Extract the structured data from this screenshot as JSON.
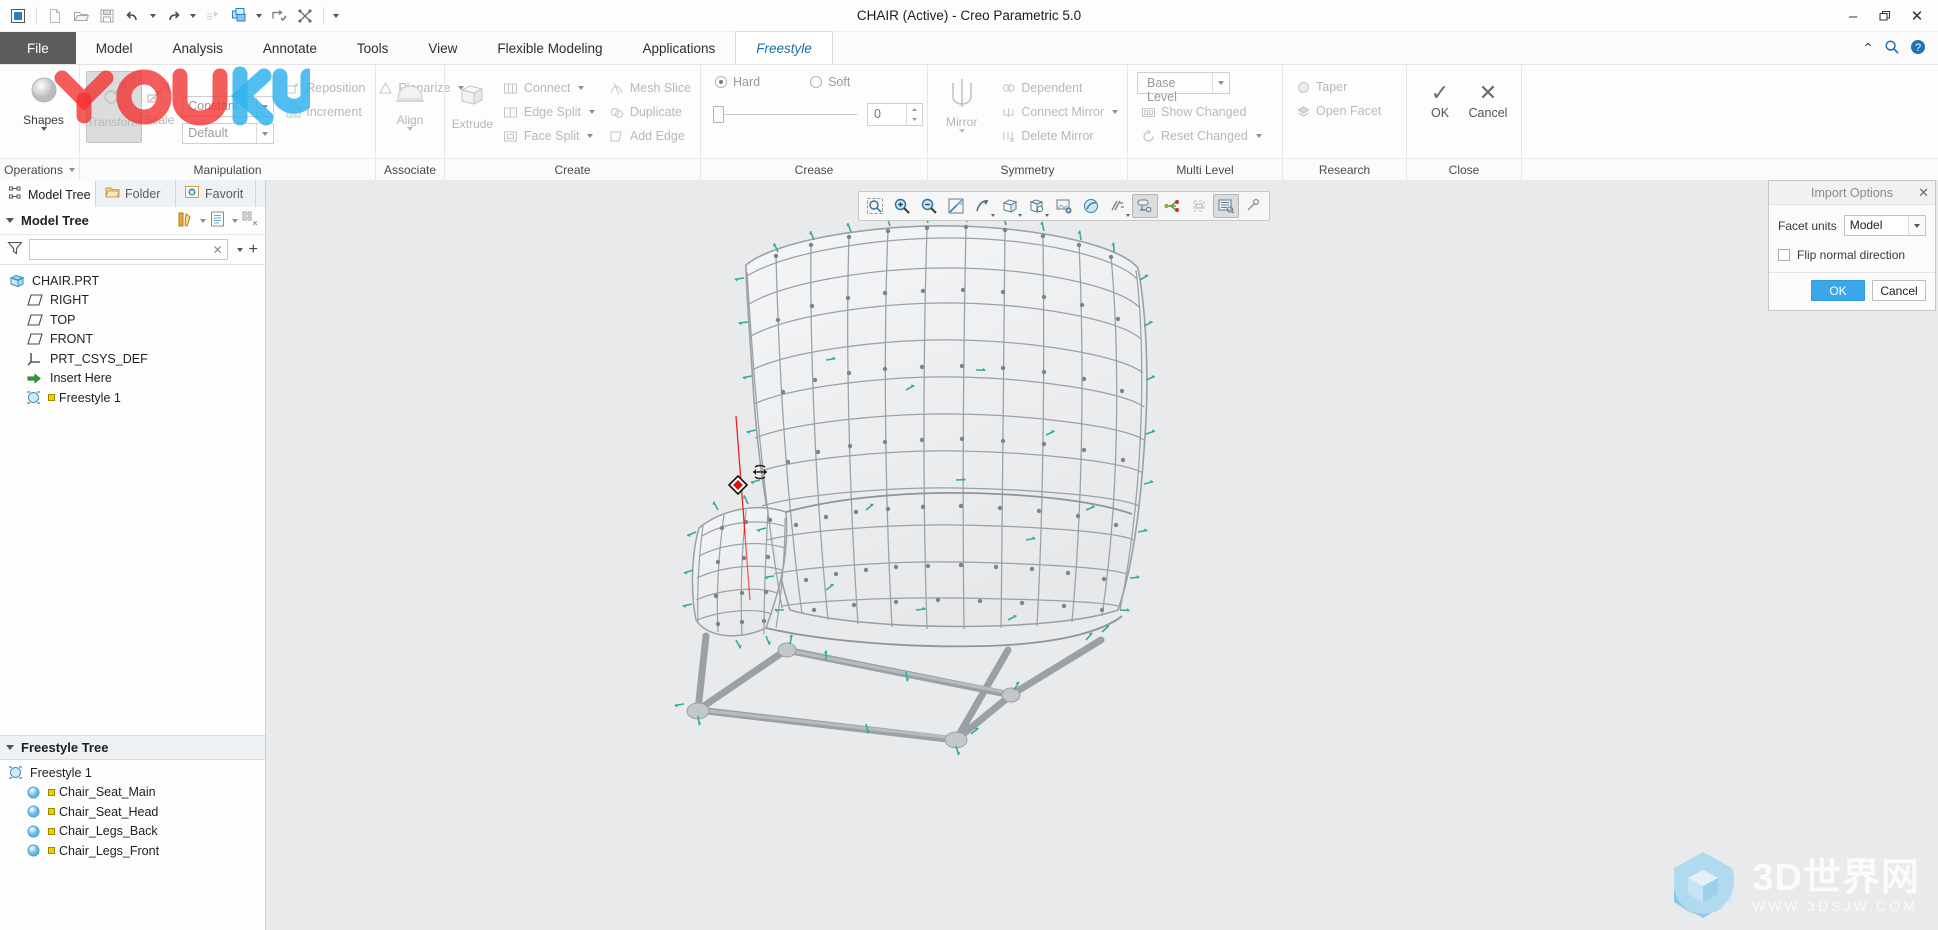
{
  "window": {
    "title": "CHAIR (Active) - Creo Parametric 5.0",
    "minimize": "–",
    "restore": "❐",
    "close": "✕"
  },
  "quick_access": {
    "items": [
      {
        "name": "app-window-icon",
        "label": "App"
      },
      {
        "name": "new-icon",
        "label": "New"
      },
      {
        "name": "open-icon",
        "label": "Open"
      },
      {
        "name": "save-icon",
        "label": "Save"
      },
      {
        "name": "undo-icon",
        "label": "Undo"
      },
      {
        "name": "redo-icon",
        "label": "Redo"
      },
      {
        "name": "regenerate-icon",
        "label": "Regenerate"
      },
      {
        "name": "window-switch-icon",
        "label": "Window"
      },
      {
        "name": "close-window-icon",
        "label": "Close Window"
      },
      {
        "name": "detach-icon",
        "label": "Detach"
      },
      {
        "name": "customize-qat-icon",
        "label": "Customize Quick Access Toolbar"
      }
    ]
  },
  "tabs": [
    {
      "label": "File",
      "kind": "file"
    },
    {
      "label": "Model",
      "kind": "normal"
    },
    {
      "label": "Analysis",
      "kind": "normal"
    },
    {
      "label": "Annotate",
      "kind": "normal"
    },
    {
      "label": "Tools",
      "kind": "normal"
    },
    {
      "label": "View",
      "kind": "normal"
    },
    {
      "label": "Flexible Modeling",
      "kind": "normal"
    },
    {
      "label": "Applications",
      "kind": "normal"
    },
    {
      "label": "Freestyle",
      "kind": "active"
    }
  ],
  "tabstrip_right": {
    "collapse": "⌃",
    "search": "search-icon",
    "help": "help-icon"
  },
  "ribbon": {
    "groups": [
      {
        "label": "Operations",
        "has_dropdown": true,
        "big": [
          {
            "label": "Shapes",
            "icon": "sphere-icon",
            "dropdown": true,
            "disabled": false
          }
        ],
        "small": []
      },
      {
        "label": "Manipulation",
        "has_dropdown": false,
        "big": [
          {
            "label": "Transform",
            "icon": "transform-icon",
            "dropdown": false,
            "disabled": true,
            "boxed": true
          },
          {
            "label": "Scale",
            "icon": "scale-icon",
            "dropdown": false,
            "disabled": true
          }
        ],
        "combos": [
          {
            "value": "Constant",
            "name": "constant-combo"
          },
          {
            "value": "Default",
            "name": "default-combo"
          }
        ],
        "small": [
          {
            "label": "Reposition",
            "icon": "reposition-icon",
            "caret": false,
            "disabled": true
          },
          {
            "label": "Planarize",
            "icon": "planarize-icon",
            "caret": true,
            "disabled": true
          },
          {
            "label": "Increment",
            "icon": "increment-icon",
            "caret": false,
            "disabled": true
          }
        ]
      },
      {
        "label": "Associate",
        "big": [
          {
            "label": "Align",
            "icon": "align-icon",
            "dropdown": true,
            "disabled": true
          }
        ],
        "small": []
      },
      {
        "label": "Create",
        "big": [
          {
            "label": "Extrude",
            "icon": "extrude-icon",
            "dropdown": false,
            "disabled": true
          }
        ],
        "small": [
          {
            "label": "Connect",
            "icon": "connect-icon",
            "caret": true,
            "disabled": true
          },
          {
            "label": "Edge Split",
            "icon": "edge-split-icon",
            "caret": true,
            "disabled": true
          },
          {
            "label": "Face Split",
            "icon": "face-split-icon",
            "caret": true,
            "disabled": true
          },
          {
            "label": "Mesh Slice",
            "icon": "mesh-slice-icon",
            "caret": false,
            "disabled": true
          },
          {
            "label": "Duplicate",
            "icon": "duplicate-icon",
            "caret": false,
            "disabled": true
          },
          {
            "label": "Add Edge",
            "icon": "add-edge-icon",
            "caret": false,
            "disabled": true
          }
        ]
      },
      {
        "label": "Crease",
        "radios": [
          {
            "label": "Hard",
            "selected": true
          },
          {
            "label": "Soft",
            "selected": false
          }
        ],
        "slider_value": "0"
      },
      {
        "label": "Symmetry",
        "big": [
          {
            "label": "Mirror",
            "icon": "mirror-icon",
            "dropdown": true,
            "disabled": true
          }
        ],
        "small": [
          {
            "label": "Dependent",
            "icon": "dependent-icon",
            "caret": false,
            "disabled": true
          },
          {
            "label": "Connect Mirror",
            "icon": "connect-mirror-icon",
            "caret": true,
            "disabled": true
          },
          {
            "label": "Delete Mirror",
            "icon": "delete-mirror-icon",
            "caret": false,
            "disabled": true
          }
        ]
      },
      {
        "label": "Multi Level",
        "boxed_button": {
          "label": "Base Level",
          "caret": true
        },
        "small": [
          {
            "label": "Show Changed",
            "icon": "show-changed-icon",
            "caret": false,
            "disabled": true
          },
          {
            "label": "Reset Changed",
            "icon": "reset-changed-icon",
            "caret": true,
            "disabled": true
          }
        ]
      },
      {
        "label": "Research",
        "small": [
          {
            "label": "Taper",
            "icon": "taper-icon",
            "caret": false,
            "disabled": true
          },
          {
            "label": "Open Facet",
            "icon": "open-facet-icon",
            "caret": false,
            "disabled": true
          }
        ]
      },
      {
        "label": "Close",
        "actions": [
          {
            "label": "OK",
            "glyph": "✓",
            "name": "ok-button"
          },
          {
            "label": "Cancel",
            "glyph": "✕",
            "name": "cancel-button"
          }
        ]
      }
    ]
  },
  "left_panel": {
    "tabs": [
      {
        "label": "Model Tree",
        "icon": "model-tree-icon",
        "active": true
      },
      {
        "label": "Folder",
        "icon": "folder-icon",
        "active": false
      },
      {
        "label": "Favorit",
        "icon": "favorites-icon",
        "active": false
      }
    ],
    "model_tree": {
      "header": "Model Tree",
      "toolbar": [
        {
          "name": "settings-tools-icon"
        },
        {
          "name": "display-icon"
        },
        {
          "name": "tree-columns-icon"
        }
      ],
      "filter_placeholder": "",
      "filter_value": "",
      "nodes": [
        {
          "label": "CHAIR.PRT",
          "icon": "part-icon",
          "indent": 0
        },
        {
          "label": "RIGHT",
          "icon": "datum-plane-icon",
          "indent": 1
        },
        {
          "label": "TOP",
          "icon": "datum-plane-icon",
          "indent": 1
        },
        {
          "label": "FRONT",
          "icon": "datum-plane-icon",
          "indent": 1
        },
        {
          "label": "PRT_CSYS_DEF",
          "icon": "csys-icon",
          "indent": 1
        },
        {
          "label": "Insert Here",
          "icon": "insert-here-icon",
          "indent": 1
        },
        {
          "label": "Freestyle 1",
          "icon": "freestyle-icon",
          "indent": 1,
          "flag": true
        }
      ]
    },
    "freestyle_tree": {
      "header": "Freestyle Tree",
      "nodes": [
        {
          "label": "Freestyle 1",
          "icon": "freestyle-icon",
          "indent": 0,
          "flag": false
        },
        {
          "label": "Chair_Seat_Main",
          "icon": "surface-icon",
          "indent": 1,
          "flag": true
        },
        {
          "label": "Chair_Seat_Head",
          "icon": "surface-icon",
          "indent": 1,
          "flag": true
        },
        {
          "label": "Chair_Legs_Back",
          "icon": "surface-icon",
          "indent": 1,
          "flag": true
        },
        {
          "label": "Chair_Legs_Front",
          "icon": "surface-icon",
          "indent": 1,
          "flag": true
        }
      ]
    }
  },
  "graphics_toolbar": {
    "buttons": [
      {
        "name": "zoom-to-fit-icon",
        "split": false,
        "selected": false
      },
      {
        "name": "zoom-in-icon",
        "split": false,
        "selected": false
      },
      {
        "name": "zoom-out-icon",
        "split": false,
        "selected": false
      },
      {
        "name": "refit-icon",
        "split": false,
        "selected": false
      },
      {
        "name": "saved-orientations-icon",
        "split": true,
        "selected": false
      },
      {
        "name": "display-style-icon",
        "split": true,
        "selected": false
      },
      {
        "name": "perspective-view-icon",
        "split": true,
        "selected": false
      },
      {
        "name": "scene-icon",
        "split": false,
        "selected": false
      },
      {
        "name": "appearance-icon",
        "split": false,
        "selected": false
      },
      {
        "name": "datum-display-icon",
        "split": true,
        "selected": false
      },
      {
        "name": "annotation-display-icon",
        "split": false,
        "selected": true
      },
      {
        "name": "spin-center-icon",
        "split": false,
        "selected": false
      },
      {
        "name": "layer-display-icon",
        "split": false,
        "selected": false
      },
      {
        "name": "view-manager-icon",
        "split": false,
        "selected": true
      },
      {
        "name": "edit-section-icon",
        "split": false,
        "selected": false
      }
    ]
  },
  "import_options": {
    "title": "Import Options",
    "close": "✕",
    "facet_units_label": "Facet units",
    "facet_units_value": "Model",
    "flip_normal_label": "Flip normal direction",
    "flip_normal_checked": false,
    "ok_label": "OK",
    "cancel_label": "Cancel"
  },
  "watermarks": {
    "youku": "YOUKU",
    "site_name": "3D世界网",
    "site_url": "WWW.3DSJW.COM"
  },
  "colors": {
    "accent": "#3ba7e8",
    "file_tab": "#5c5c5c",
    "viewport_bg": "#e9eaec",
    "mesh": "#9aa0a5",
    "handle": "#2fae9b",
    "axis_red": "#ee2222"
  },
  "model": {
    "name": "CHAIR",
    "description": "Freestyle wireframe chair surface with control mesh and normal handles"
  }
}
